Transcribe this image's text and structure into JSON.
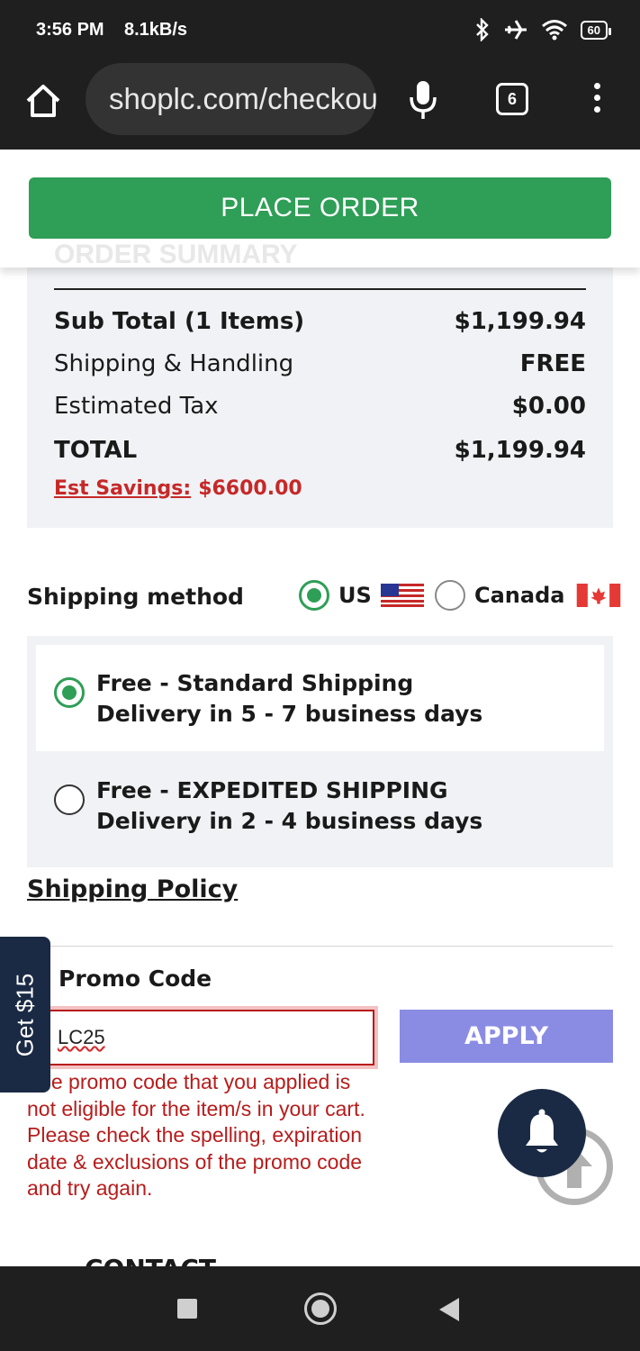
{
  "status_bar": {
    "time": "3:56 PM",
    "speed": "8.1kB/s",
    "battery": "60"
  },
  "browser": {
    "url": "shoplc.com/checkout",
    "tab_count": "6"
  },
  "header": {
    "place_order_label": "PLACE ORDER",
    "summary_title": "ORDER SUMMARY"
  },
  "summary": {
    "rows": [
      {
        "label": "Sub Total (1 Items)",
        "value": "$1,199.94"
      },
      {
        "label": "Shipping & Handling",
        "value": "FREE"
      },
      {
        "label": "Estimated Tax",
        "value": "$0.00"
      },
      {
        "label": "TOTAL",
        "value": "$1,199.94"
      }
    ],
    "savings_label": "Est Savings:",
    "savings_value": "$6600.00"
  },
  "shipping": {
    "label": "Shipping method",
    "countries": [
      {
        "label": "US",
        "selected": true
      },
      {
        "label": "Canada",
        "selected": false
      }
    ],
    "options": [
      {
        "title": "Free - Standard Shipping",
        "subtitle": "Delivery in 5 - 7 business days",
        "selected": true
      },
      {
        "title": "Free - EXPEDITED SHIPPING",
        "subtitle": "Delivery in 2 - 4 business days",
        "selected": false
      }
    ],
    "policy_link": "Shipping Policy"
  },
  "promo": {
    "label": "Promo Code",
    "value": "LC25",
    "apply_label": "APPLY",
    "error": "The promo code that you applied is not eligible for the item/s in your cart. Please check the spelling, expiration date & exclusions of the promo code and try again."
  },
  "contact_title": "CONTACT",
  "floating": {
    "get_offer_label": "Get $15"
  },
  "colors": {
    "primary_green": "#2f9e57",
    "error_red": "#b71c1c",
    "apply_purple": "#8a8ce4",
    "navy": "#1b2a44"
  }
}
